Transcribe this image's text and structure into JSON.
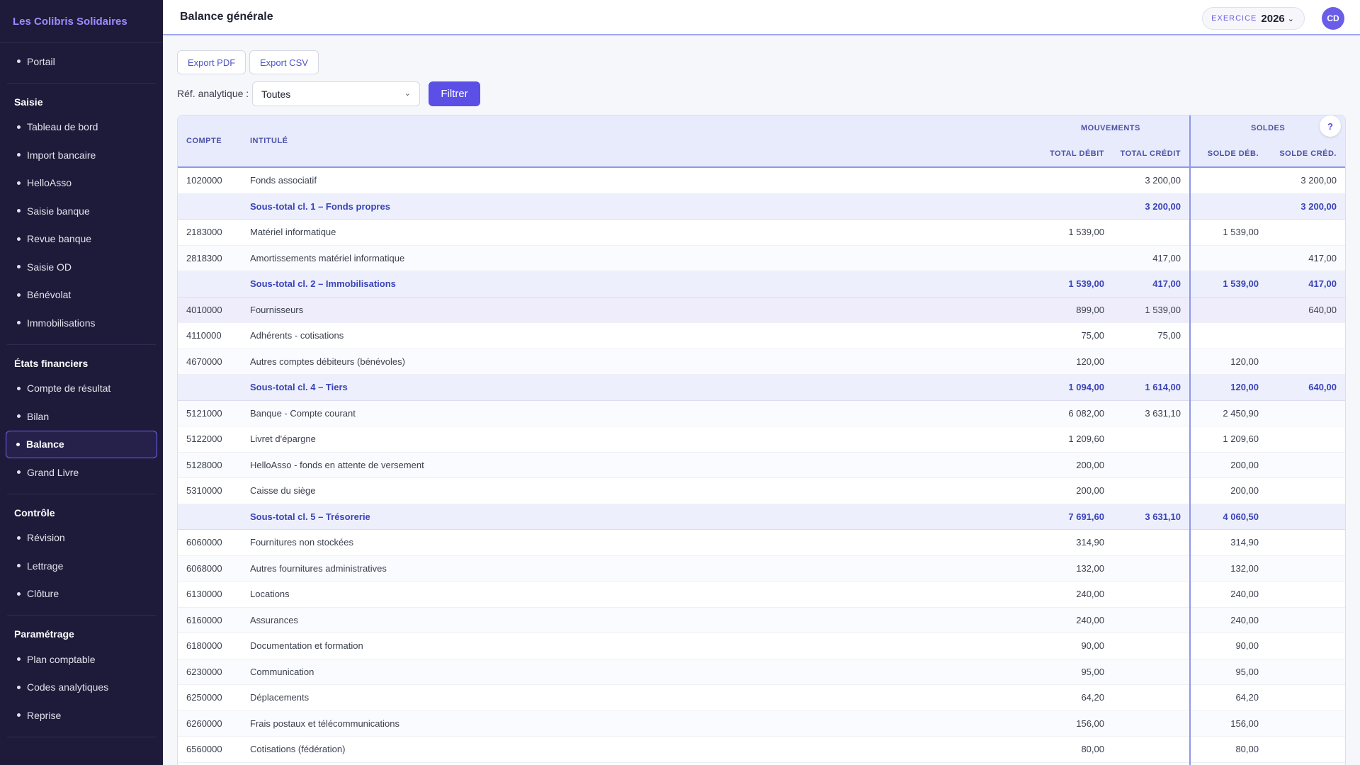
{
  "sidebar": {
    "brand": "Les Colibris Solidaires",
    "top_item": "Portail",
    "groups": [
      {
        "title": "Saisie",
        "items": [
          "Tableau de bord",
          "Import bancaire",
          "HelloAsso",
          "Saisie banque",
          "Revue banque",
          "Saisie OD",
          "Bénévolat",
          "Immobilisations"
        ]
      },
      {
        "title": "États financiers",
        "items": [
          "Compte de résultat",
          "Bilan",
          "Balance",
          "Grand Livre"
        ]
      },
      {
        "title": "Contrôle",
        "items": [
          "Révision",
          "Lettrage",
          "Clôture"
        ]
      },
      {
        "title": "Paramétrage",
        "items": [
          "Plan comptable",
          "Codes analytiques",
          "Reprise"
        ]
      }
    ],
    "active_item": "Balance"
  },
  "header": {
    "title": "Balance générale",
    "exercise_label": "EXERCICE",
    "exercise_year": "2026",
    "avatar_initials": "CD"
  },
  "toolbar": {
    "export_pdf": "Export PDF",
    "export_csv": "Export CSV",
    "filter_label": "Réf. analytique :",
    "filter_value": "Toutes",
    "filter_button": "Filtrer"
  },
  "table": {
    "headers": {
      "compte": "COMPTE",
      "intitule": "INTITULÉ",
      "mouvements": "MOUVEMENTS",
      "soldes": "SOLDES",
      "total_debit": "TOTAL DÉBIT",
      "total_credit": "TOTAL CRÉDIT",
      "solde_deb": "SOLDE DÉB.",
      "solde_cred": "SOLDE CRÉD.",
      "help": "?"
    },
    "rows": [
      {
        "compte": "1020000",
        "intitule": "Fonds associatif",
        "td": "",
        "tc": "3 200,00",
        "sd": "",
        "sc": "3 200,00"
      },
      {
        "compte": "",
        "intitule": "Sous-total cl. 1 – Fonds propres",
        "td": "",
        "tc": "3 200,00",
        "sd": "",
        "sc": "3 200,00",
        "sub": true
      },
      {
        "compte": "2183000",
        "intitule": "Matériel informatique",
        "td": "1 539,00",
        "tc": "",
        "sd": "1 539,00",
        "sc": ""
      },
      {
        "compte": "2818300",
        "intitule": "Amortissements matériel informatique",
        "td": "",
        "tc": "417,00",
        "sd": "",
        "sc": "417,00"
      },
      {
        "compte": "",
        "intitule": "Sous-total cl. 2 – Immobilisations",
        "td": "1 539,00",
        "tc": "417,00",
        "sd": "1 539,00",
        "sc": "417,00",
        "sub": true
      },
      {
        "compte": "4010000",
        "intitule": "Fournisseurs",
        "td": "899,00",
        "tc": "1 539,00",
        "sd": "",
        "sc": "640,00",
        "hl": true
      },
      {
        "compte": "4110000",
        "intitule": "Adhérents - cotisations",
        "td": "75,00",
        "tc": "75,00",
        "sd": "",
        "sc": ""
      },
      {
        "compte": "4670000",
        "intitule": "Autres comptes débiteurs (bénévoles)",
        "td": "120,00",
        "tc": "",
        "sd": "120,00",
        "sc": ""
      },
      {
        "compte": "",
        "intitule": "Sous-total cl. 4 – Tiers",
        "td": "1 094,00",
        "tc": "1 614,00",
        "sd": "120,00",
        "sc": "640,00",
        "sub": true
      },
      {
        "compte": "5121000",
        "intitule": "Banque - Compte courant",
        "td": "6 082,00",
        "tc": "3 631,10",
        "sd": "2 450,90",
        "sc": ""
      },
      {
        "compte": "5122000",
        "intitule": "Livret d'épargne",
        "td": "1 209,60",
        "tc": "",
        "sd": "1 209,60",
        "sc": ""
      },
      {
        "compte": "5128000",
        "intitule": "HelloAsso - fonds en attente de versement",
        "td": "200,00",
        "tc": "",
        "sd": "200,00",
        "sc": ""
      },
      {
        "compte": "5310000",
        "intitule": "Caisse du siège",
        "td": "200,00",
        "tc": "",
        "sd": "200,00",
        "sc": ""
      },
      {
        "compte": "",
        "intitule": "Sous-total cl. 5 – Trésorerie",
        "td": "7 691,60",
        "tc": "3 631,10",
        "sd": "4 060,50",
        "sc": "",
        "sub": true
      },
      {
        "compte": "6060000",
        "intitule": "Fournitures non stockées",
        "td": "314,90",
        "tc": "",
        "sd": "314,90",
        "sc": ""
      },
      {
        "compte": "6068000",
        "intitule": "Autres fournitures administratives",
        "td": "132,00",
        "tc": "",
        "sd": "132,00",
        "sc": ""
      },
      {
        "compte": "6130000",
        "intitule": "Locations",
        "td": "240,00",
        "tc": "",
        "sd": "240,00",
        "sc": ""
      },
      {
        "compte": "6160000",
        "intitule": "Assurances",
        "td": "240,00",
        "tc": "",
        "sd": "240,00",
        "sc": ""
      },
      {
        "compte": "6180000",
        "intitule": "Documentation et formation",
        "td": "90,00",
        "tc": "",
        "sd": "90,00",
        "sc": ""
      },
      {
        "compte": "6230000",
        "intitule": "Communication",
        "td": "95,00",
        "tc": "",
        "sd": "95,00",
        "sc": ""
      },
      {
        "compte": "6250000",
        "intitule": "Déplacements",
        "td": "64,20",
        "tc": "",
        "sd": "64,20",
        "sc": ""
      },
      {
        "compte": "6260000",
        "intitule": "Frais postaux et télécommunications",
        "td": "156,00",
        "tc": "",
        "sd": "156,00",
        "sc": ""
      },
      {
        "compte": "6560000",
        "intitule": "Cotisations (fédération)",
        "td": "80,00",
        "tc": "",
        "sd": "80,00",
        "sc": ""
      }
    ]
  }
}
